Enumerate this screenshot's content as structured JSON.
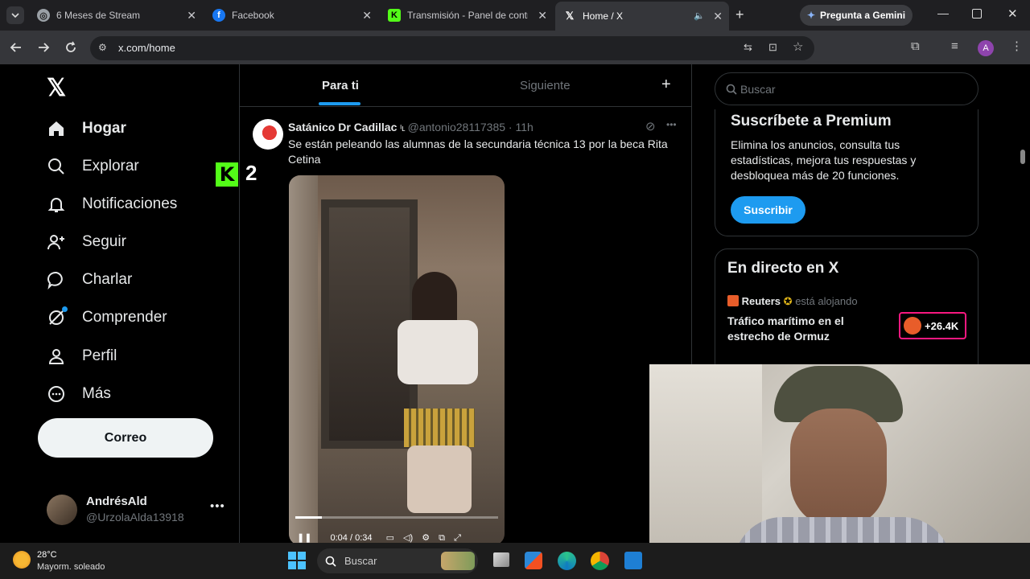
{
  "tabs": [
    {
      "title": "6 Meses de Stream",
      "icon": "globe-icon"
    },
    {
      "title": "Facebook",
      "icon": "facebook-icon"
    },
    {
      "title": "Transmisión - Panel de control",
      "icon": "kick-icon"
    },
    {
      "title": "Home / X",
      "icon": "x-logo-icon"
    }
  ],
  "gemini_button": "Pregunta a Gemini",
  "url": "x.com/home",
  "profile_initial": "A",
  "nav": {
    "home": "Hogar",
    "explore": "Explorar",
    "notifications": "Notificaciones",
    "follow": "Seguir",
    "chat": "Charlar",
    "grok": "Comprender",
    "profile": "Perfil",
    "more": "Más",
    "post_button": "Correo"
  },
  "account": {
    "name": "AndrésAld",
    "handle": "@UrzolaAlda13918"
  },
  "overlay_counter": "2",
  "feed": {
    "tab_foryou": "Para ti",
    "tab_following": "Siguiente",
    "post": {
      "author": "Satánico Dr Cadillac",
      "handle": "@antonio28117385",
      "time": "· 11h",
      "text": "Se están peleando las alumnas de la secundaria técnica 13 por la beca Rita Cetina",
      "video_time": "0:04 / 0:34",
      "video_progress": 0.13
    }
  },
  "search_placeholder": "Buscar",
  "premium": {
    "title": "Suscríbete a Premium",
    "body": "Elimina los anuncios, consulta tus estadísticas, mejora tus respuestas y desbloquea más de 20 funciones.",
    "button": "Suscribir"
  },
  "live": {
    "title": "En directo en X",
    "host": "Reuters",
    "status": "está alojando",
    "space_title": "Tráfico marítimo en el estrecho de Ormuz",
    "listeners": "+26.4K"
  },
  "taskbar": {
    "temp": "28°C",
    "weather": "Mayorm. soleado",
    "search": "Buscar"
  },
  "colors": {
    "accent": "#1d9bf0",
    "kick_green": "#53fc18",
    "live_pink": "#f91880"
  }
}
